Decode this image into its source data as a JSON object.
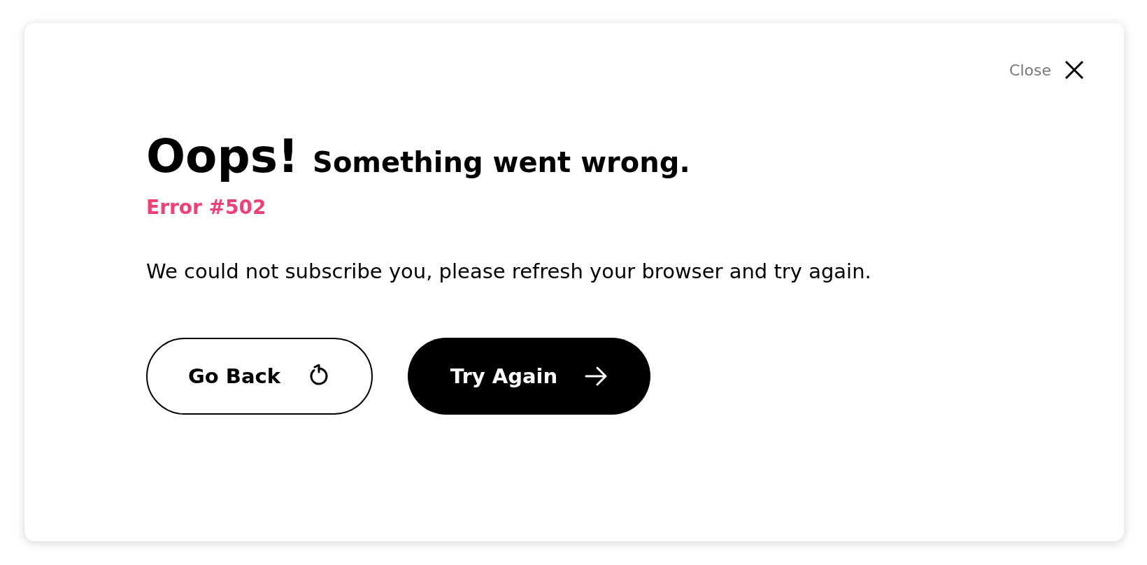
{
  "close": {
    "label": "Close"
  },
  "heading": {
    "title": "Oops!",
    "subtitle": "Something went wrong."
  },
  "error_code": "Error #502",
  "message": "We could not subscribe you, please refresh your browser and try again.",
  "buttons": [
    {
      "label": "Go Back",
      "kind": "outline"
    },
    {
      "label": "Try Again",
      "kind": "filled"
    }
  ]
}
